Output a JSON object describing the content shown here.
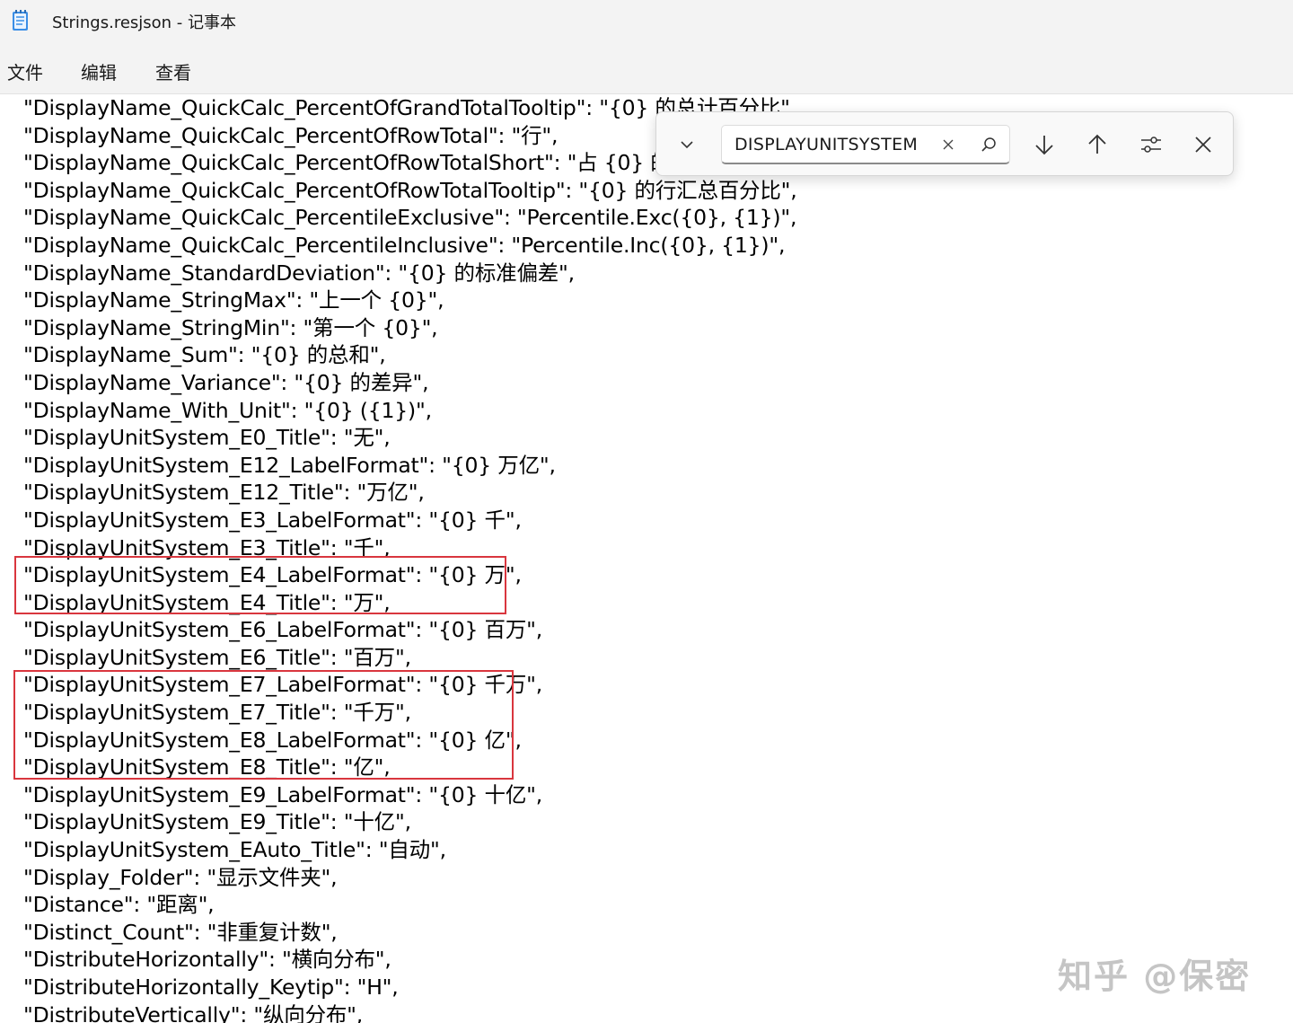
{
  "window": {
    "title": "Strings.resjson - 记事本",
    "app_icon": "notepad-icon"
  },
  "menu": {
    "items": [
      "文件",
      "编辑",
      "查看"
    ]
  },
  "editor": {
    "lines": [
      "\"DisplayName_QuickCalc_PercentOfGrandTotalTooltip\": \"{0} 的总计百分比\",",
      "\"DisplayName_QuickCalc_PercentOfRowTotal\": \"行\",",
      "\"DisplayName_QuickCalc_PercentOfRowTotalShort\": \"占 {0} 的",
      "\"DisplayName_QuickCalc_PercentOfRowTotalTooltip\": \"{0} 的行汇总百分比\",",
      "\"DisplayName_QuickCalc_PercentileExclusive\": \"Percentile.Exc({0}, {1})\",",
      "\"DisplayName_QuickCalc_PercentileInclusive\": \"Percentile.Inc({0}, {1})\",",
      "\"DisplayName_StandardDeviation\": \"{0} 的标准偏差\",",
      "\"DisplayName_StringMax\": \"上一个 {0}\",",
      "\"DisplayName_StringMin\": \"第一个 {0}\",",
      "\"DisplayName_Sum\": \"{0} 的总和\",",
      "\"DisplayName_Variance\": \"{0} 的差异\",",
      "\"DisplayName_With_Unit\": \"{0} ({1})\",",
      "\"DisplayUnitSystem_E0_Title\": \"无\",",
      "\"DisplayUnitSystem_E12_LabelFormat\": \"{0} 万亿\",",
      "\"DisplayUnitSystem_E12_Title\": \"万亿\",",
      "\"DisplayUnitSystem_E3_LabelFormat\": \"{0} 千\",",
      "\"DisplayUnitSystem_E3_Title\": \"千\",",
      "\"DisplayUnitSystem_E4_LabelFormat\": \"{0} 万\",",
      "\"DisplayUnitSystem_E4_Title\": \"万\",",
      "\"DisplayUnitSystem_E6_LabelFormat\": \"{0} 百万\",",
      "\"DisplayUnitSystem_E6_Title\": \"百万\",",
      "\"DisplayUnitSystem_E7_LabelFormat\": \"{0} 千万\",",
      "\"DisplayUnitSystem_E7_Title\": \"千万\",",
      "\"DisplayUnitSystem_E8_LabelFormat\": \"{0} 亿\",",
      "\"DisplayUnitSystem_E8_Title\": \"亿\",",
      "\"DisplayUnitSystem_E9_LabelFormat\": \"{0} 十亿\",",
      "\"DisplayUnitSystem_E9_Title\": \"十亿\",",
      "\"DisplayUnitSystem_EAuto_Title\": \"自动\",",
      "\"Display_Folder\": \"显示文件夹\",",
      "\"Distance\": \"距离\",",
      "\"Distinct_Count\": \"非重复计数\",",
      "\"DistributeHorizontally\": \"横向分布\",",
      "\"DistributeHorizontally_Keytip\": \"H\",",
      "\"DistributeVertically\": \"纵向分布\","
    ]
  },
  "find": {
    "query": "DISPLAYUNITSYSTEM",
    "toggle_icon": "chevron-down-icon",
    "clear_icon": "close-icon",
    "search_icon": "search-icon",
    "next_icon": "arrow-down-icon",
    "prev_icon": "arrow-up-icon",
    "options_icon": "sliders-icon",
    "close_icon": "close-icon"
  },
  "highlight_color": "#d9363e",
  "watermark": "知乎 @保密"
}
